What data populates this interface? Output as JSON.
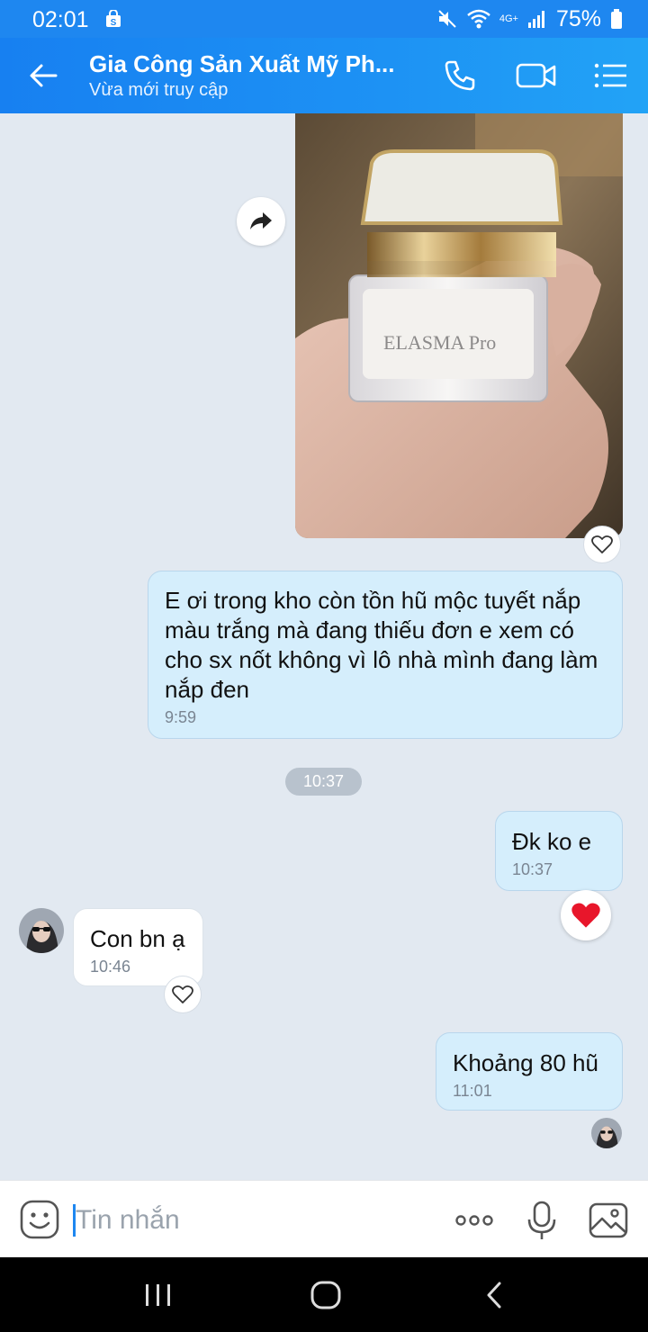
{
  "status_bar": {
    "time": "02:01",
    "battery": "75%",
    "network": "4G+"
  },
  "header": {
    "title": "Gia Công Sản Xuất Mỹ Ph...",
    "subtitle": "Vừa mới truy cập"
  },
  "photo": {
    "product_text": "ELASMA Pro"
  },
  "messages": [
    {
      "side": "out",
      "text": "E ơi trong kho còn tồn hũ mộc tuyết nắp màu trắng mà đang thiếu đơn e xem có cho sx nốt không vì lô nhà mình đang làm nắp đen",
      "time": "9:59"
    },
    {
      "side": "out",
      "text": "Đk ko e",
      "time": "10:37"
    },
    {
      "side": "in",
      "text": "Con bn ạ",
      "time": "10:46"
    },
    {
      "side": "out",
      "text": "Khoảng 80 hũ",
      "time": "11:01"
    }
  ],
  "time_separator": "10:37",
  "input": {
    "placeholder": "Tin nhắn"
  },
  "colors": {
    "accent": "#1e87f0",
    "out_bubble": "#d5eefc",
    "background": "#e2e9f1"
  }
}
